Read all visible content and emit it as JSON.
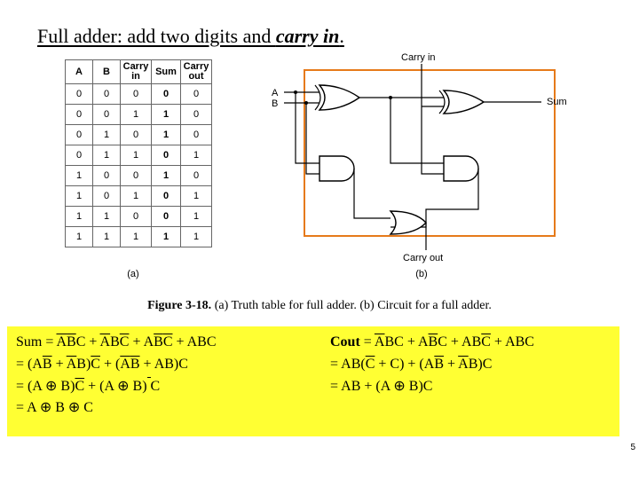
{
  "title_prefix": "Full adder: add two digits and ",
  "title_em": "carry in",
  "title_suffix": ".",
  "truth": {
    "headers": [
      "A",
      "B",
      "Carry\nin",
      "Sum",
      "Carry\nout"
    ],
    "rows": [
      [
        "0",
        "0",
        "0",
        "0",
        "0"
      ],
      [
        "0",
        "0",
        "1",
        "1",
        "0"
      ],
      [
        "0",
        "1",
        "0",
        "1",
        "0"
      ],
      [
        "0",
        "1",
        "1",
        "0",
        "1"
      ],
      [
        "1",
        "0",
        "0",
        "1",
        "0"
      ],
      [
        "1",
        "0",
        "1",
        "0",
        "1"
      ],
      [
        "1",
        "1",
        "0",
        "0",
        "1"
      ],
      [
        "1",
        "1",
        "1",
        "1",
        "1"
      ]
    ]
  },
  "circuit_labels": {
    "a": "A",
    "b": "B",
    "carry_in": "Carry in",
    "sum": "Sum",
    "carry_out": "Carry out"
  },
  "sub_a": "(a)",
  "sub_b": "(b)",
  "caption_bold": "Figure 3-18.",
  "caption_rest": "  (a) Truth table for full adder.  (b) Circuit for a full adder.",
  "eq": {
    "sum": [
      "Sum = ¬A¬BC + ¬AB¬C + A¬B¬C + ABC",
      "= (A¬B + ¬AB)¬C + (¬A¬B + AB)C",
      "= (A ⊕ B)¬C + (A ⊕ B)‾ C",
      "= A ⊕ B ⊕ C"
    ],
    "cout": [
      "Cout = ¬ABC + A¬BC + AB¬C + ABC",
      "= AB(¬C + C) + (A¬B + ¬AB)C",
      "= AB + (A ⊕ B)C"
    ]
  },
  "page_number": "5"
}
